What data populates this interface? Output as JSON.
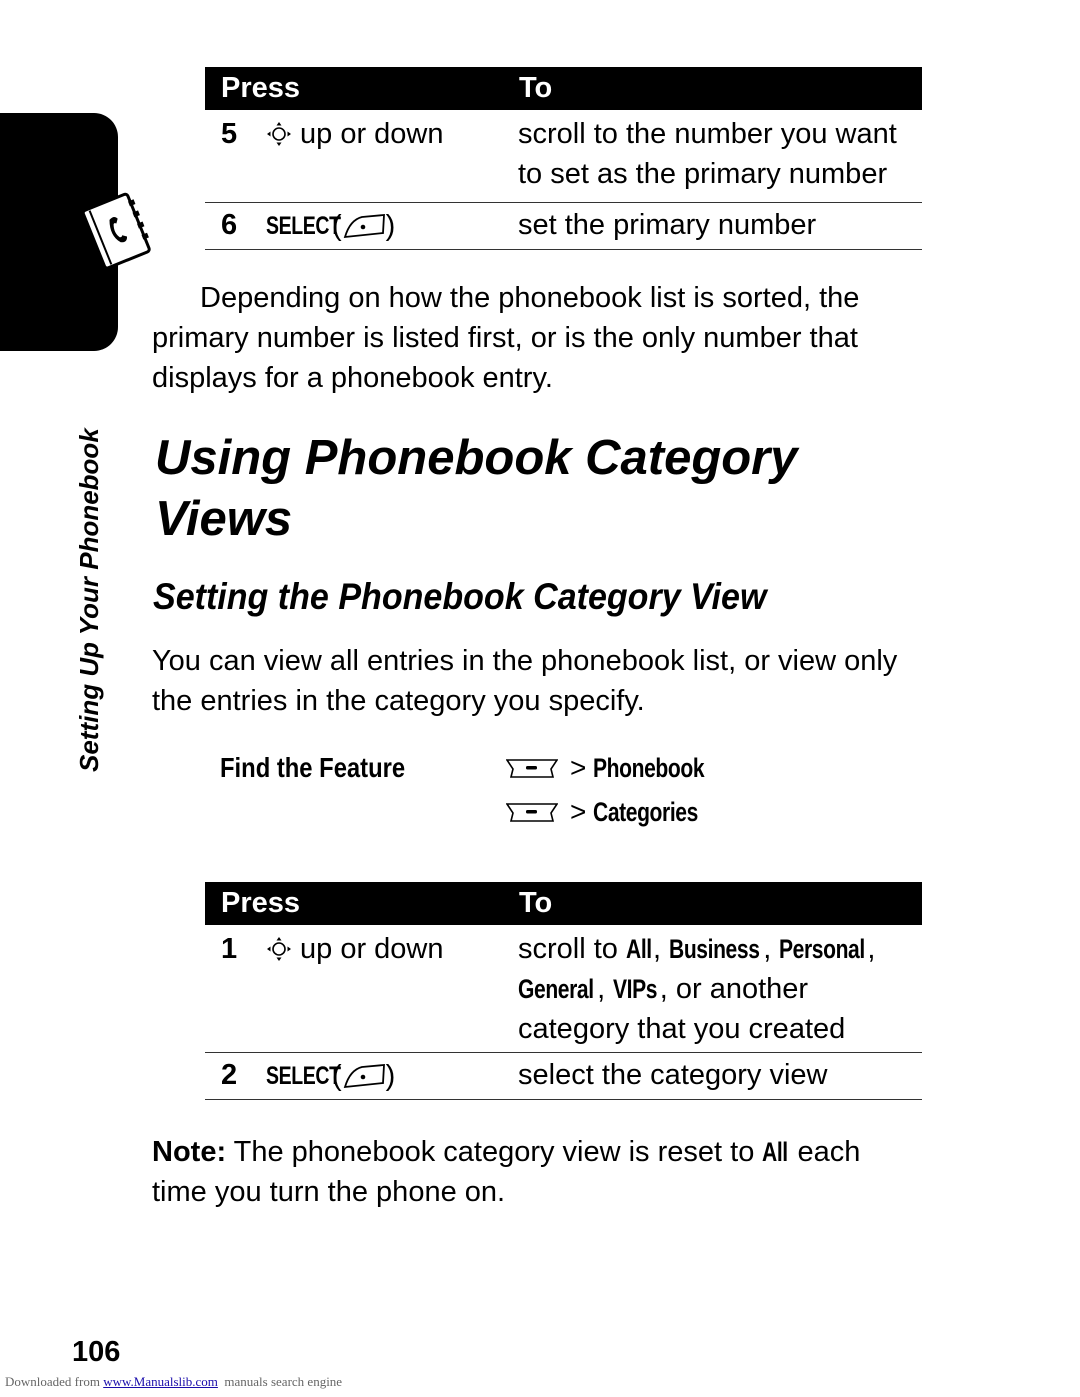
{
  "side_tab": {
    "icon": "phonebook-icon",
    "section_label": "Setting Up Your Phonebook"
  },
  "table1": {
    "headers": {
      "press": "Press",
      "to": "To"
    },
    "rows": [
      {
        "num": "5",
        "press_icon": "nav-key-icon",
        "press_text": "up or down",
        "to": "scroll to the number you want to set as the primary number"
      },
      {
        "num": "6",
        "press_key": "SELECT",
        "press_icon": "select-softkey-icon",
        "to": "set the primary number"
      }
    ]
  },
  "para1": "Depending on how the phonebook list is sorted, the primary number is listed first, or is the only number that displays for a phonebook entry.",
  "heading1": "Using Phonebook Category Views",
  "heading2": "Setting the Phonebook Category View",
  "para2": "You can view all entries in the phonebook list, or view only the entries in the category you specify.",
  "find_feature": {
    "label": "Find the Feature",
    "paths": [
      {
        "icon": "menu-key-icon",
        "separator": ">",
        "item": "Phonebook"
      },
      {
        "icon": "menu-key-icon",
        "separator": ">",
        "item": "Categories"
      }
    ]
  },
  "table2": {
    "headers": {
      "press": "Press",
      "to": "To"
    },
    "rows": [
      {
        "num": "1",
        "press_icon": "nav-key-icon",
        "press_text": "up or down",
        "to_prefix": "scroll to ",
        "categories": [
          "All",
          "Business",
          "Personal",
          "General",
          "VIPs"
        ],
        "to_suffix": ", or another category that you created"
      },
      {
        "num": "2",
        "press_key": "SELECT",
        "press_icon": "select-softkey-icon",
        "to": "select the category view"
      }
    ]
  },
  "note": {
    "label": "Note:",
    "text_before": " The phonebook category view is reset to ",
    "keyword": "All",
    "text_after": " each time you turn the phone on."
  },
  "page_number": "106",
  "footer": {
    "prefix": "Downloaded from ",
    "link": "www.Manualslib.com",
    "suffix": "  manuals search engine"
  }
}
